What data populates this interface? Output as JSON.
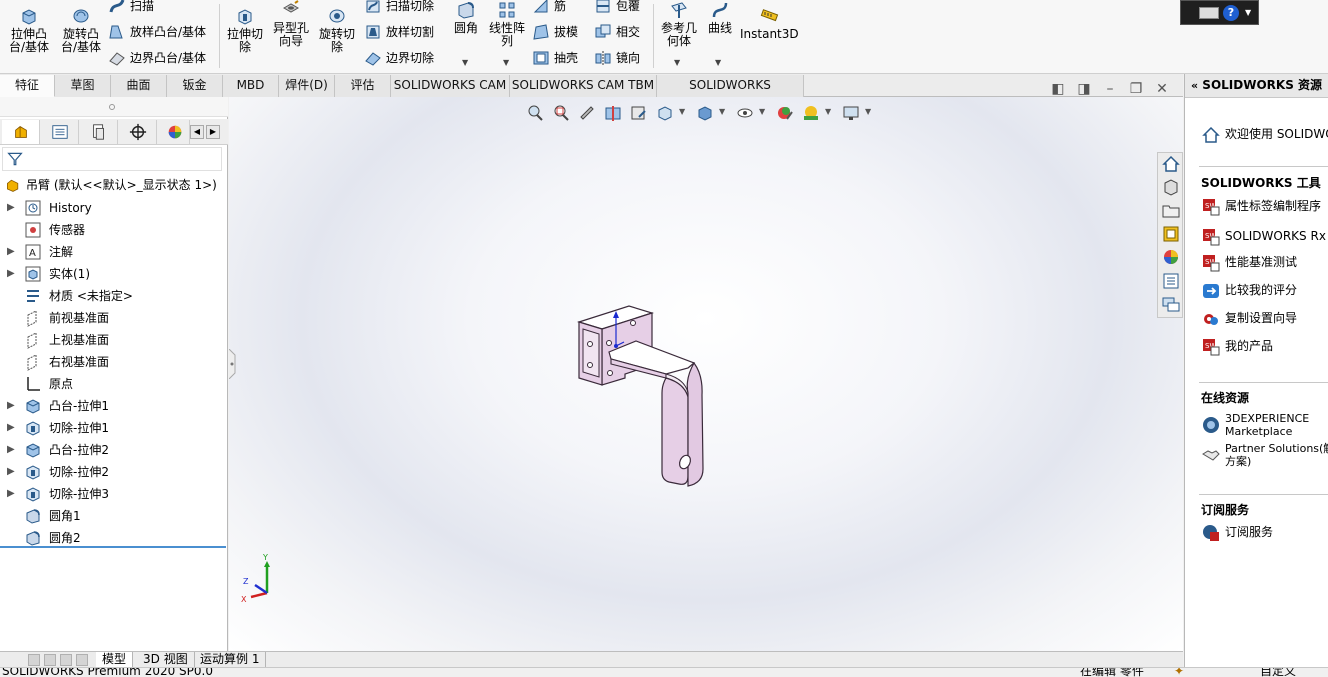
{
  "ribbon": {
    "extrude_boss_label": "拉伸凸\n台/基体",
    "revolve_boss_label": "旋转凸\n台/基体",
    "sweep_label": "扫描",
    "loft_boss_label": "放样凸台/基体",
    "boundary_boss_label": "边界凸台/基体",
    "extrude_cut_label": "拉伸切\n除",
    "hole_wizard_label": "异型孔\n向导",
    "revolve_cut_label": "旋转切\n除",
    "sweep_cut_label": "扫描切除",
    "loft_cut_label": "放样切割",
    "boundary_cut_label": "边界切除",
    "fillet_label": "圆角",
    "linear_pattern_label": "线性阵\n列",
    "rib_label": "筋",
    "draft_label": "拔模",
    "shell_label": "抽壳",
    "wrap_label": "包覆",
    "intersect_label": "相交",
    "mirror_label": "镜向",
    "ref_geometry_label": "参考几\n何体",
    "curves_label": "曲线",
    "instant3d_label": "Instant3D"
  },
  "command_tabs": [
    {
      "label": "特征"
    },
    {
      "label": "草图"
    },
    {
      "label": "曲面"
    },
    {
      "label": "钣金"
    },
    {
      "label": "MBD"
    },
    {
      "label": "焊件(D)"
    },
    {
      "label": "评估"
    },
    {
      "label": "SOLIDWORKS CAM"
    },
    {
      "label": "SOLIDWORKS CAM TBM"
    },
    {
      "label": "SOLIDWORKS Inspection"
    }
  ],
  "feature_tree": {
    "root_label": "吊臂  (默认<<默认>_显示状态 1>)",
    "nodes": [
      {
        "label": "History",
        "expandable": true,
        "icon": "history-icon"
      },
      {
        "label": "传感器",
        "expandable": false,
        "icon": "sensor-icon"
      },
      {
        "label": "注解",
        "expandable": true,
        "icon": "annotation-icon"
      },
      {
        "label": "实体(1)",
        "expandable": true,
        "icon": "solid-body-icon"
      },
      {
        "label": "材质 <未指定>",
        "expandable": false,
        "icon": "material-icon"
      },
      {
        "label": "前视基准面",
        "expandable": false,
        "icon": "plane-icon"
      },
      {
        "label": "上视基准面",
        "expandable": false,
        "icon": "plane-icon"
      },
      {
        "label": "右视基准面",
        "expandable": false,
        "icon": "plane-icon"
      },
      {
        "label": "原点",
        "expandable": false,
        "icon": "origin-icon"
      },
      {
        "label": "凸台-拉伸1",
        "expandable": true,
        "icon": "boss-extrude-icon"
      },
      {
        "label": "切除-拉伸1",
        "expandable": true,
        "icon": "cut-extrude-icon"
      },
      {
        "label": "凸台-拉伸2",
        "expandable": true,
        "icon": "boss-extrude-icon"
      },
      {
        "label": "切除-拉伸2",
        "expandable": true,
        "icon": "cut-extrude-icon"
      },
      {
        "label": "切除-拉伸3",
        "expandable": true,
        "icon": "cut-extrude-icon"
      },
      {
        "label": "圆角1",
        "expandable": false,
        "icon": "fillet-icon"
      },
      {
        "label": "圆角2",
        "expandable": false,
        "icon": "fillet-icon"
      }
    ]
  },
  "task_pane": {
    "title": "SOLIDWORKS 资源",
    "welcome_label": "欢迎使用 SOLIDWORKS",
    "tools_title": "SOLIDWORKS 工具",
    "tools": [
      {
        "label": "属性标签编制程序"
      },
      {
        "label": "SOLIDWORKS Rx"
      },
      {
        "label": "性能基准测试"
      },
      {
        "label": "比较我的评分"
      },
      {
        "label": "复制设置向导"
      },
      {
        "label": "我的产品"
      }
    ],
    "online_title": "在线资源",
    "marketplace_line1": "3DEXPERIENCE",
    "marketplace_line2": "Marketplace",
    "partner_line1": "Partner Solutions(解",
    "partner_line2": "方案)",
    "subscription_title": "订阅服务",
    "subscription_label": "订阅服务"
  },
  "triad": {
    "x": "X",
    "y": "Y",
    "z": "Z"
  },
  "bottom_tabs": [
    {
      "label": "模型"
    },
    {
      "label": "3D 视图"
    },
    {
      "label": "运动算例 1"
    }
  ],
  "status": {
    "app_version": "SOLIDWORKS Premium 2020 SP0.0",
    "editing": "在编辑 零件",
    "custom": "自定义"
  },
  "colors": {
    "part_face": "#e6cfe6",
    "part_edge": "#3a2a3a",
    "accent_blue": "#4a8fd0"
  }
}
